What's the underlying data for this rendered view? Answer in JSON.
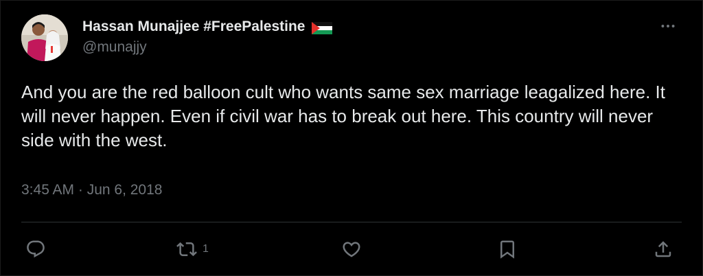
{
  "author": {
    "display_name": "Hassan Munajjee #FreePalestine",
    "flag_icon": "palestine-flag-icon",
    "handle": "@munajjy"
  },
  "tweet": {
    "text": "And you are the red balloon cult who wants same sex marriage leagalized here. It will never happen. Even if civil war has to break out here. This country will never side with the west.",
    "timestamp": "3:45 AM · Jun 6, 2018"
  },
  "actions": {
    "reply": {
      "icon": "reply-icon"
    },
    "retweet": {
      "icon": "retweet-icon",
      "count": "1"
    },
    "like": {
      "icon": "heart-icon"
    },
    "bookmark": {
      "icon": "bookmark-icon"
    },
    "share": {
      "icon": "share-icon"
    }
  },
  "colors": {
    "background": "#000000",
    "primary_text": "#e7e9ea",
    "secondary_text": "#71767b",
    "divider": "#2f3336"
  }
}
